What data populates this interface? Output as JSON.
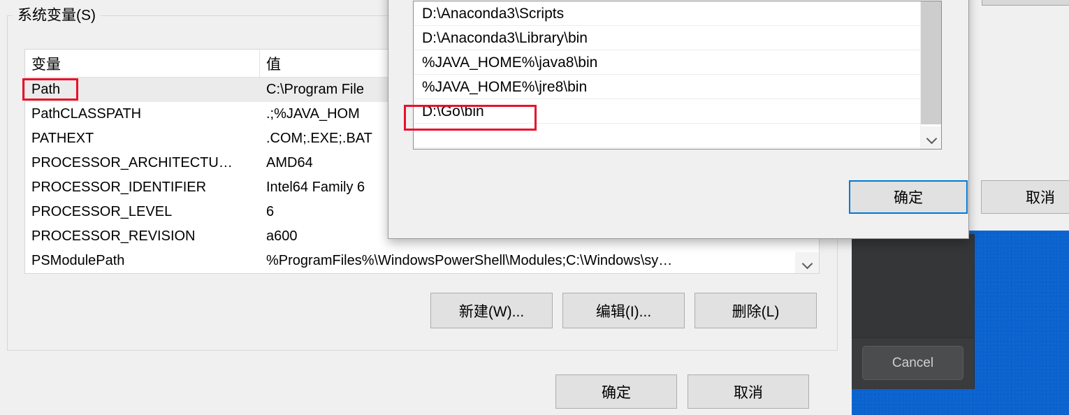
{
  "env_dialog": {
    "group_title": "系统变量(S)",
    "table": {
      "columns": [
        "变量",
        "值"
      ],
      "rows": [
        {
          "variable": "Path",
          "value": "C:\\Program File",
          "selected": true
        },
        {
          "variable": "PathCLASSPATH",
          "value": ".;%JAVA_HOM",
          "selected": false
        },
        {
          "variable": "PATHEXT",
          "value": ".COM;.EXE;.BAT",
          "selected": false
        },
        {
          "variable": "PROCESSOR_ARCHITECTU…",
          "value": "AMD64",
          "selected": false
        },
        {
          "variable": "PROCESSOR_IDENTIFIER",
          "value": "Intel64 Family 6",
          "selected": false
        },
        {
          "variable": "PROCESSOR_LEVEL",
          "value": "6",
          "selected": false
        },
        {
          "variable": "PROCESSOR_REVISION",
          "value": "a600",
          "selected": false
        },
        {
          "variable": "PSModulePath",
          "value": "%ProgramFiles%\\WindowsPowerShell\\Modules;C:\\Windows\\sy…",
          "selected": false
        }
      ],
      "scroll_down_icon": "chevron-down-icon"
    },
    "buttons": {
      "new": "新建(W)...",
      "edit": "编辑(I)...",
      "delete": "删除(L)",
      "ok": "确定",
      "cancel": "取消"
    }
  },
  "edit_path_dialog": {
    "entries": [
      "D:\\Anaconda3\\Scripts",
      "D:\\Anaconda3\\Library\\bin",
      "%JAVA_HOME%\\java8\\bin",
      "%JAVA_HOME%\\jre8\\bin",
      "D:\\Go\\bin",
      ""
    ],
    "scroll_down_icon": "chevron-down-icon",
    "buttons": {
      "ok": "确定",
      "cancel": "取消"
    }
  },
  "background_app": {
    "cancel_label": "Cancel"
  },
  "colors": {
    "accent_focus": "#0078d7",
    "annotation_red": "#e8102a",
    "desktop_blue": "#0a63cf",
    "dialog_face": "#f0f0f0",
    "button_face": "#e1e1e1",
    "selection_row": "#ebebeb"
  },
  "annotations": [
    {
      "name": "path-variable-highlight",
      "target": "Path"
    },
    {
      "name": "go-bin-entry-highlight",
      "target": "D:\\Go\\bin"
    }
  ]
}
